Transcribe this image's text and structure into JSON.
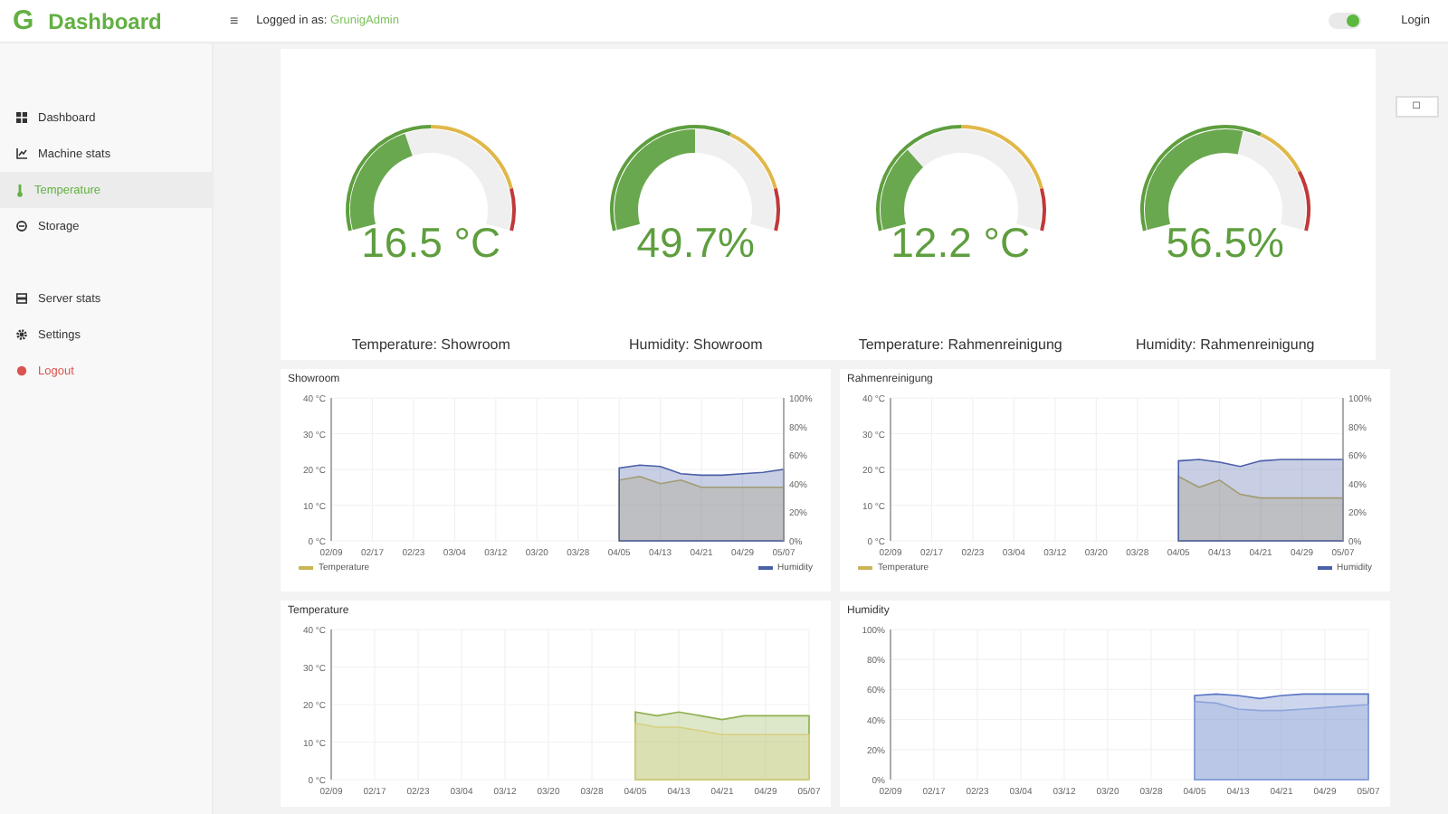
{
  "header": {
    "logo_letter": "G",
    "title": "Dashboard",
    "menu_glyph": "≡",
    "logged_in_prefix": "Logged in as:",
    "user": "GrunigAdmin",
    "toggle_on": true,
    "login": "Login"
  },
  "sidebar": {
    "groups": [
      [
        {
          "label": "Dashboard",
          "selected": false,
          "kind": "normal"
        },
        {
          "label": "Machine stats",
          "selected": false,
          "kind": "normal"
        },
        {
          "label": "Temperature",
          "selected": true,
          "kind": "normal"
        },
        {
          "label": "Storage",
          "selected": false,
          "kind": "normal"
        }
      ],
      [
        {
          "label": "Server stats",
          "selected": false,
          "kind": "normal"
        },
        {
          "label": "Settings",
          "selected": false,
          "kind": "normal"
        },
        {
          "label": "Logout",
          "selected": false,
          "kind": "danger"
        }
      ]
    ]
  },
  "corner_button": {
    "glyph": "□"
  },
  "gauges": [
    {
      "value": "16.5 °C",
      "label": "Temperature: Showroom"
    },
    {
      "value": "49.7%",
      "label": "Humidity: Showroom"
    },
    {
      "value": "12.2 °C",
      "label": "Temperature: Rahmenreinigung"
    },
    {
      "value": "56.5%",
      "label": "Humidity: Rahmenreinigung"
    }
  ],
  "charts": [
    {
      "chart_data": {
        "type": "area",
        "title": "Showroom",
        "grid": true,
        "ylim": [
          0,
          40
        ],
        "y2lim": [
          0,
          100
        ],
        "categories": [
          "02/09",
          null,
          "02/17",
          null,
          "02/23",
          null,
          "03/04",
          null,
          "03/12",
          null,
          "03/20",
          null,
          "03/28",
          null,
          "04/05",
          null,
          "04/13",
          null,
          "04/21",
          null,
          "04/29",
          null,
          "05/07"
        ],
        "yticks": [
          {
            "value": 0,
            "label": "0 °C"
          },
          {
            "value": 10,
            "label": "10 °C"
          },
          {
            "value": 20,
            "label": "20 °C"
          },
          {
            "value": 30,
            "label": "30 °C"
          },
          {
            "value": 40,
            "label": "40 °C"
          }
        ],
        "y2ticks": [
          {
            "value": 0,
            "label": "0%"
          },
          {
            "value": 20,
            "label": "20%"
          },
          {
            "value": 40,
            "label": "40%"
          },
          {
            "value": 60,
            "label": "60%"
          },
          {
            "value": 80,
            "label": "80%"
          },
          {
            "value": 100,
            "label": "100%"
          }
        ],
        "series": [
          {
            "name": "Temperature",
            "color": "#c9b458",
            "values": [
              null,
              null,
              null,
              null,
              null,
              null,
              null,
              null,
              null,
              null,
              null,
              null,
              null,
              null,
              17,
              18,
              16,
              17,
              15,
              15,
              15,
              15,
              15
            ]
          },
          {
            "name": "Humidity",
            "color": "#4a5fa8",
            "axis": "y2",
            "values": [
              null,
              null,
              null,
              null,
              null,
              null,
              null,
              null,
              null,
              null,
              null,
              null,
              null,
              null,
              51,
              53,
              52,
              47,
              46,
              46,
              47,
              48,
              50
            ]
          }
        ]
      }
    },
    {
      "chart_data": {
        "type": "area",
        "title": "Rahmenreinigung",
        "grid": true,
        "ylim": [
          0,
          40
        ],
        "y2lim": [
          0,
          100
        ],
        "categories": [
          "02/09",
          null,
          "02/17",
          null,
          "02/23",
          null,
          "03/04",
          null,
          "03/12",
          null,
          "03/20",
          null,
          "03/28",
          null,
          "04/05",
          null,
          "04/13",
          null,
          "04/21",
          null,
          "04/29",
          null,
          "05/07"
        ],
        "yticks": [
          {
            "value": 0,
            "label": "0 °C"
          },
          {
            "value": 10,
            "label": "10 °C"
          },
          {
            "value": 20,
            "label": "20 °C"
          },
          {
            "value": 30,
            "label": "30 °C"
          },
          {
            "value": 40,
            "label": "40 °C"
          }
        ],
        "y2ticks": [
          {
            "value": 0,
            "label": "0%"
          },
          {
            "value": 20,
            "label": "20%"
          },
          {
            "value": 40,
            "label": "40%"
          },
          {
            "value": 60,
            "label": "60%"
          },
          {
            "value": 80,
            "label": "80%"
          },
          {
            "value": 100,
            "label": "100%"
          }
        ],
        "series": [
          {
            "name": "Temperature",
            "color": "#c9b458",
            "values": [
              null,
              null,
              null,
              null,
              null,
              null,
              null,
              null,
              null,
              null,
              null,
              null,
              null,
              null,
              18,
              15,
              17,
              13,
              12,
              12,
              12,
              12,
              12
            ]
          },
          {
            "name": "Humidity",
            "color": "#4a5fa8",
            "axis": "y2",
            "values": [
              null,
              null,
              null,
              null,
              null,
              null,
              null,
              null,
              null,
              null,
              null,
              null,
              null,
              null,
              56,
              57,
              55,
              52,
              56,
              57,
              57,
              57,
              57
            ]
          }
        ]
      }
    },
    {
      "chart_data": {
        "type": "area",
        "title": "Temperature",
        "grid": true,
        "ylim": [
          0,
          40
        ],
        "categories": [
          "02/09",
          null,
          "02/17",
          null,
          "02/23",
          null,
          "03/04",
          null,
          "03/12",
          null,
          "03/20",
          null,
          "03/28",
          null,
          "04/05",
          null,
          "04/13",
          null,
          "04/21",
          null,
          "04/29",
          null,
          "05/07"
        ],
        "yticks": [
          {
            "value": 0,
            "label": "0 °C"
          },
          {
            "value": 10,
            "label": "10 °C"
          },
          {
            "value": 20,
            "label": "20 °C"
          },
          {
            "value": 30,
            "label": "30 °C"
          },
          {
            "value": 40,
            "label": "40 °C"
          }
        ],
        "series": [
          {
            "color": "#8fb04f",
            "values": [
              null,
              null,
              null,
              null,
              null,
              null,
              null,
              null,
              null,
              null,
              null,
              null,
              null,
              null,
              18,
              17,
              18,
              17,
              16,
              17,
              17,
              17,
              17
            ]
          },
          {
            "color": "#d6d07e",
            "values": [
              null,
              null,
              null,
              null,
              null,
              null,
              null,
              null,
              null,
              null,
              null,
              null,
              null,
              null,
              15,
              14,
              14,
              13,
              12,
              12,
              12,
              12,
              12
            ]
          }
        ]
      }
    },
    {
      "chart_data": {
        "type": "area",
        "title": "Humidity",
        "grid": true,
        "ylim": [
          0,
          100
        ],
        "categories": [
          "02/09",
          null,
          "02/17",
          null,
          "02/23",
          null,
          "03/04",
          null,
          "03/12",
          null,
          "03/20",
          null,
          "03/28",
          null,
          "04/05",
          null,
          "04/13",
          null,
          "04/21",
          null,
          "04/29",
          null,
          "05/07"
        ],
        "yticks": [
          {
            "value": 0,
            "label": "0%"
          },
          {
            "value": 20,
            "label": "20%"
          },
          {
            "value": 40,
            "label": "40%"
          },
          {
            "value": 60,
            "label": "60%"
          },
          {
            "value": 80,
            "label": "80%"
          },
          {
            "value": 100,
            "label": "100%"
          }
        ],
        "series": [
          {
            "color": "#5a77c4",
            "values": [
              null,
              null,
              null,
              null,
              null,
              null,
              null,
              null,
              null,
              null,
              null,
              null,
              null,
              null,
              56,
              57,
              56,
              54,
              56,
              57,
              57,
              57,
              57
            ]
          },
          {
            "color": "#8fa6dc",
            "values": [
              null,
              null,
              null,
              null,
              null,
              null,
              null,
              null,
              null,
              null,
              null,
              null,
              null,
              null,
              52,
              51,
              47,
              46,
              46,
              47,
              48,
              49,
              50
            ]
          }
        ]
      }
    }
  ]
}
